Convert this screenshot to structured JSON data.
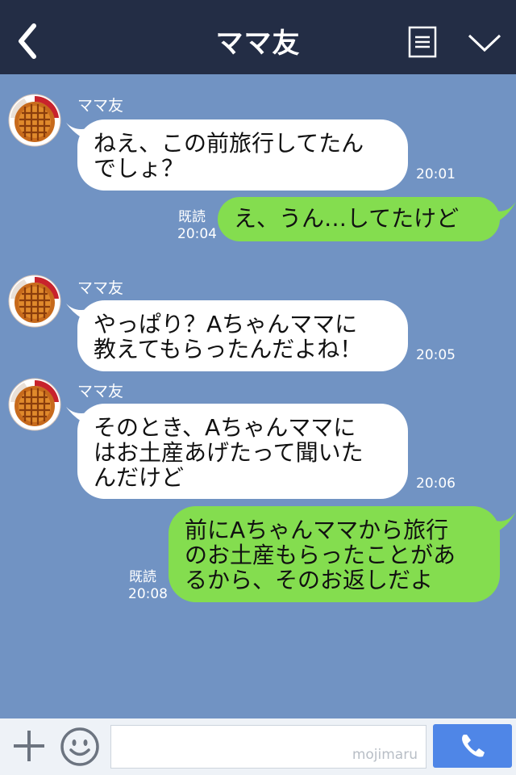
{
  "header": {
    "title": "ママ友"
  },
  "messages": [
    {
      "sender": "ママ友",
      "lines": [
        "ねえ、この前旅行してたん",
        "でしょ？"
      ],
      "time": "20:01"
    },
    {
      "lines": [
        "え、うん…してたけど"
      ],
      "read": "既読",
      "time": "20:04"
    },
    {
      "sender": "ママ友",
      "lines": [
        "やっぱり？Aちゃんママに",
        "教えてもらったんだよね！"
      ],
      "time": "20:05"
    },
    {
      "sender": "ママ友",
      "lines": [
        "そのとき、Aちゃんママに",
        "はお土産あげたって聞いた",
        "んだけど"
      ],
      "time": "20:06"
    },
    {
      "lines": [
        "前にAちゃんママから旅行",
        "のお土産もらったことがあ",
        "るから、そのお返しだよ"
      ],
      "read": "既読",
      "time": "20:08"
    }
  ],
  "footer": {
    "watermark": "mojimaru"
  },
  "icons": {
    "back": "back-chevron-icon",
    "menu": "menu-list-icon",
    "collapse": "chevron-down-icon",
    "add": "plus-icon",
    "emoji": "smiley-icon",
    "call": "phone-icon"
  },
  "colors": {
    "header": "#232d45",
    "background": "#7193c3",
    "outgoing": "#84dd4f",
    "incoming": "#ffffff",
    "call": "#4f86e7"
  }
}
